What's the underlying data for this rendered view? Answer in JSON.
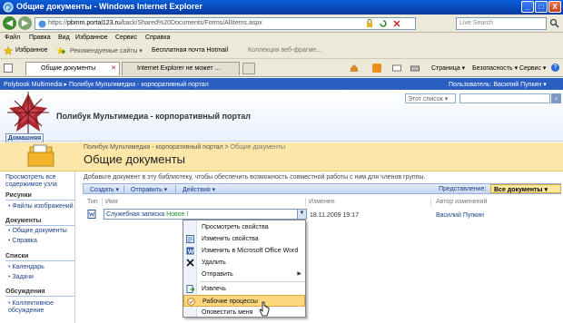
{
  "window": {
    "title": "Общие документы - Windows Internet Explorer",
    "buttons": [
      "_",
      "□",
      "X"
    ]
  },
  "address": {
    "prefix": "https://",
    "host": "pbmm.portal123.ru",
    "path": "/back/Shared%20Documents/Forms/AllItems.aspx",
    "search_placeholder": "Live Search"
  },
  "menu": [
    "Файл",
    "Правка",
    "Вид",
    "Избранное",
    "Сервис",
    "Справка"
  ],
  "favorites": {
    "label": "Избранное",
    "items": [
      "Рекомендуемые сайты ▾",
      "Бесплатная почта Hotmail",
      "Коллекция веб-фрагме..."
    ]
  },
  "tabs": [
    {
      "label": "Общие документы",
      "active": true
    },
    {
      "label": "Internet Explorer не может ...",
      "active": false
    }
  ],
  "commands": [
    "Страница ▾",
    "Безопасность ▾",
    "Сервис ▾",
    "?"
  ],
  "sp_bar": {
    "site": "Polybook Multimedia ▸ Полибук Мультимедиа - корпоративный портал",
    "user": "Пользователь: Василий Пупкин ▾"
  },
  "header": {
    "site_title": "Полибук Мультимедиа - корпоративный портал",
    "list_scope": "Этот список ▾",
    "home_tab": "Домашняя"
  },
  "page": {
    "breadcrumb_site": "Полибук Мультимедиа - корпоративный портал",
    "breadcrumb_sep": " > ",
    "breadcrumb_current": "Общие документы",
    "title": "Общие документы",
    "description": "Добавьте документ в эту библиотеку, чтобы обеспечить возможность совместной работы с ним для членов группы."
  },
  "leftnav": {
    "view_all": "Просмотреть все содержимое узла",
    "sections": [
      {
        "heading": "Рисунки",
        "items": [
          "Файлы изображений"
        ]
      },
      {
        "heading": "Документы",
        "items": [
          "Общие документы",
          "Справка"
        ]
      },
      {
        "heading": "Списки",
        "items": [
          "Календарь",
          "Задачи"
        ]
      },
      {
        "heading": "Обсуждения",
        "items": [
          "Коллективное обсуждение"
        ]
      }
    ]
  },
  "toolbar": {
    "create": "Создать ▾",
    "send": "Отправить ▾",
    "actions": "Действия ▾",
    "view_label": "Представление:",
    "view_value": "Все документы ▾"
  },
  "columns": {
    "type": "Тип",
    "name": "Имя",
    "modified": "Изменен",
    "author": "Автор изменений"
  },
  "row": {
    "name": "Служебная записка",
    "new_badge": "Новое !",
    "modified": "18.11.2009 19:17",
    "author": "Василий Пупкин"
  },
  "context_menu": [
    {
      "label": "Просмотреть свойства",
      "icon": "blank"
    },
    {
      "label": "Изменить свойства",
      "icon": "edit-properties-icon"
    },
    {
      "label": "Изменить в Microsoft Office Word",
      "icon": "word-icon"
    },
    {
      "label": "Удалить",
      "icon": "delete-icon"
    },
    {
      "label": "Отправить",
      "icon": "blank",
      "submenu": true
    },
    {
      "label": "Извлечь",
      "icon": "checkout-icon"
    },
    {
      "label": "Рабочие процессы",
      "icon": "workflow-icon",
      "highlighted": true
    },
    {
      "label": "Оповестить меня",
      "icon": "blank"
    }
  ],
  "colors": {
    "titlebar": "#0846b8",
    "sp_bar": "#2a5fc1",
    "title_band": "#fde7a8",
    "highlight": "#fcd77f",
    "new_badge": "#1f8f2f"
  }
}
